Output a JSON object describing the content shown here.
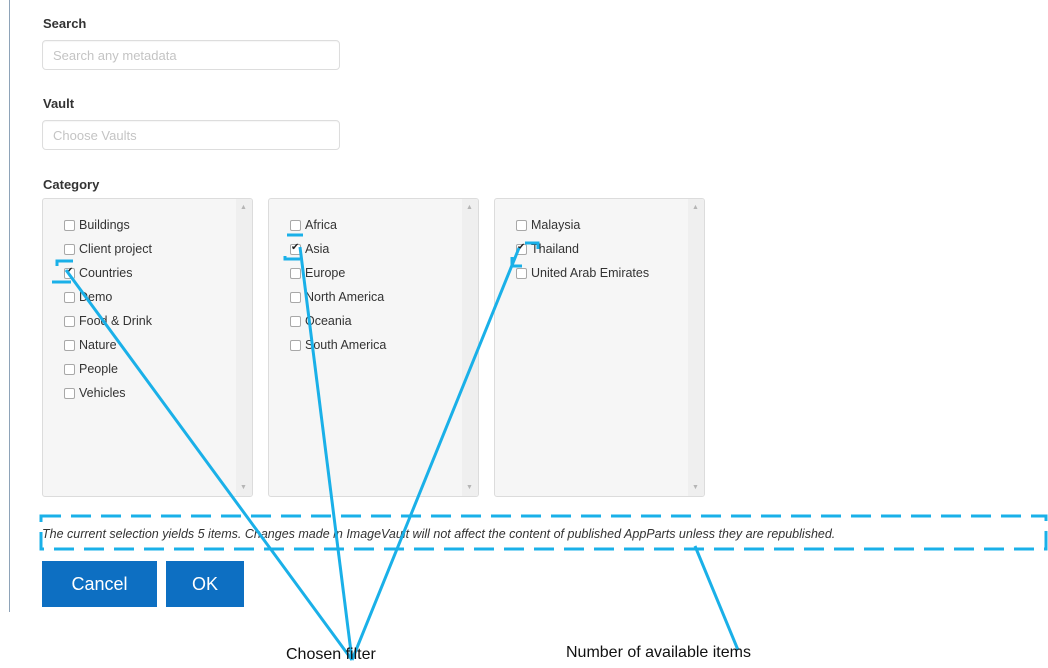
{
  "search": {
    "label": "Search",
    "placeholder": "Search any metadata",
    "value": ""
  },
  "vault": {
    "label": "Vault",
    "placeholder": "Choose Vaults",
    "value": ""
  },
  "category": {
    "label": "Category",
    "columns": [
      {
        "items": [
          {
            "label": "Buildings",
            "checked": false
          },
          {
            "label": "Client project",
            "checked": false
          },
          {
            "label": "Countries",
            "checked": true
          },
          {
            "label": "Demo",
            "checked": false
          },
          {
            "label": "Food & Drink",
            "checked": false
          },
          {
            "label": "Nature",
            "checked": false
          },
          {
            "label": "People",
            "checked": false
          },
          {
            "label": "Vehicles",
            "checked": false
          }
        ]
      },
      {
        "items": [
          {
            "label": "Africa",
            "checked": false
          },
          {
            "label": "Asia",
            "checked": true
          },
          {
            "label": "Europe",
            "checked": false
          },
          {
            "label": "North America",
            "checked": false
          },
          {
            "label": "Oceania",
            "checked": false
          },
          {
            "label": "South America",
            "checked": false
          }
        ]
      },
      {
        "items": [
          {
            "label": "Malaysia",
            "checked": false
          },
          {
            "label": "Thailand",
            "checked": true
          },
          {
            "label": "United Arab Emirates",
            "checked": false
          }
        ]
      }
    ]
  },
  "selection_message": "The current selection yields 5 items. Changes made in ImageVault will not affect the content of published AppParts unless they are republished.",
  "buttons": {
    "cancel": "Cancel",
    "ok": "OK"
  },
  "annotations": {
    "chosen_filter": "Chosen filter",
    "available_items": "Number of available items",
    "color": "#1ab0e8"
  }
}
